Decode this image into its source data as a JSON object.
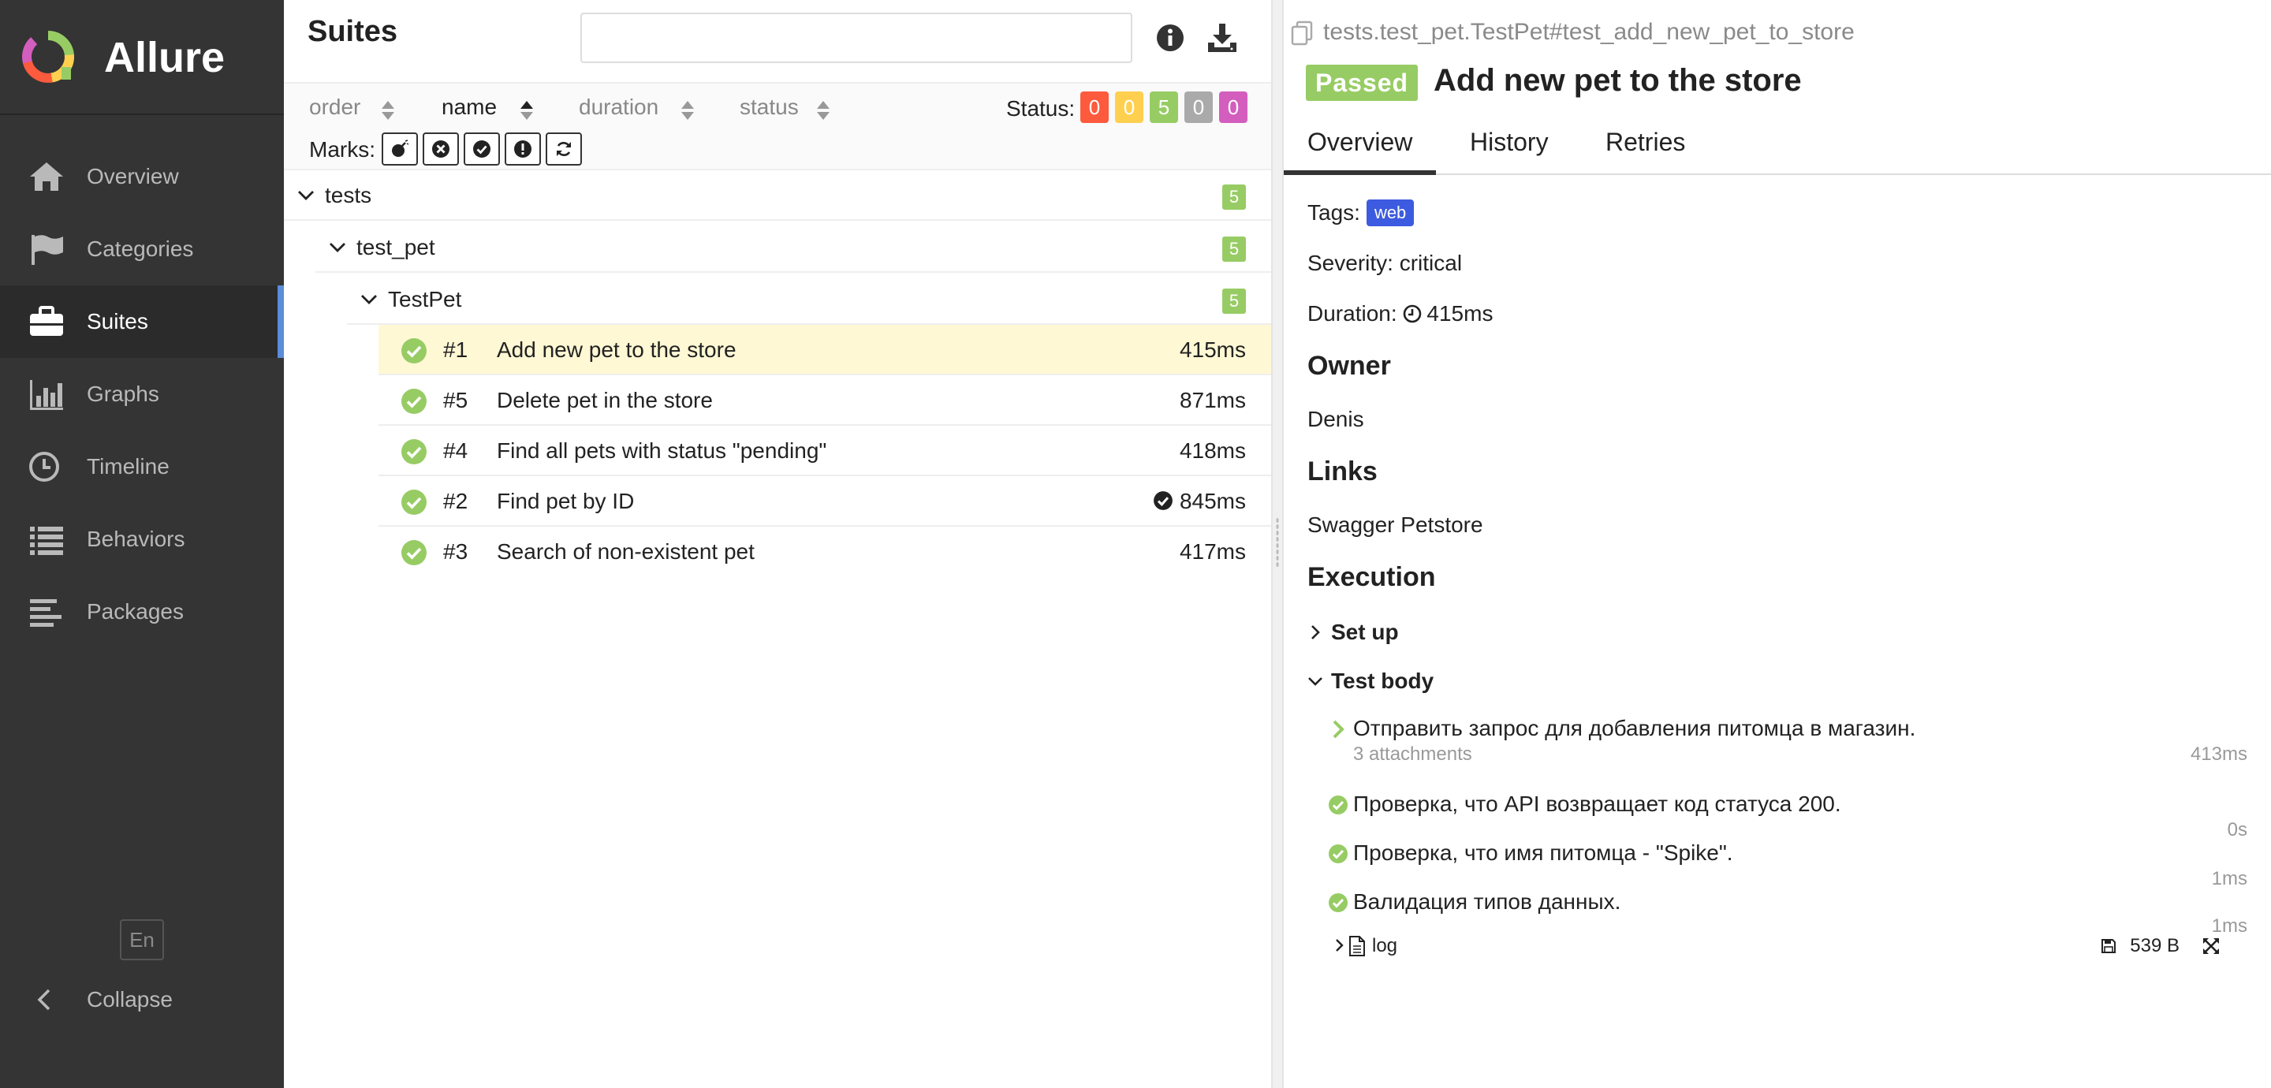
{
  "brand": {
    "name": "Allure"
  },
  "sidebar": {
    "items": [
      {
        "label": "Overview",
        "icon": "home-icon"
      },
      {
        "label": "Categories",
        "icon": "flag-icon"
      },
      {
        "label": "Suites",
        "icon": "briefcase-icon",
        "active": true
      },
      {
        "label": "Graphs",
        "icon": "bar-chart-icon"
      },
      {
        "label": "Timeline",
        "icon": "clock-icon"
      },
      {
        "label": "Behaviors",
        "icon": "list-icon"
      },
      {
        "label": "Packages",
        "icon": "align-left-icon"
      }
    ],
    "language": "En",
    "collapse_label": "Collapse"
  },
  "suites": {
    "title": "Suites",
    "search": {
      "value": "",
      "placeholder": ""
    },
    "sorters": [
      "order",
      "name",
      "duration",
      "status"
    ],
    "active_sorter": "name",
    "status_label": "Status:",
    "status_counts": [
      {
        "value": "0",
        "color": "#fd5a3e"
      },
      {
        "value": "0",
        "color": "#ffd050"
      },
      {
        "value": "5",
        "color": "#97cc64"
      },
      {
        "value": "0",
        "color": "#aaaaaa"
      },
      {
        "value": "0",
        "color": "#d35ebe"
      }
    ],
    "marks_label": "Marks:",
    "marks": [
      "flaky-bomb-icon",
      "new-failed-icon",
      "new-passed-icon",
      "new-broken-icon",
      "retries-icon"
    ],
    "tree": [
      {
        "label": "tests",
        "count": "5"
      },
      {
        "label": "test_pet",
        "count": "5"
      },
      {
        "label": "TestPet",
        "count": "5"
      }
    ],
    "tests": [
      {
        "num": "#1",
        "name": "Add new pet to the store",
        "duration": "415ms",
        "selected": true
      },
      {
        "num": "#5",
        "name": "Delete pet in the store",
        "duration": "871ms"
      },
      {
        "num": "#4",
        "name": "Find all pets with status \"pending\"",
        "duration": "418ms"
      },
      {
        "num": "#2",
        "name": "Find pet by ID",
        "duration": "845ms",
        "flag": "new-passed-icon"
      },
      {
        "num": "#3",
        "name": "Search of non-existent pet",
        "duration": "417ms"
      }
    ]
  },
  "detail": {
    "breadcrumb": "tests.test_pet.TestPet#test_add_new_pet_to_store",
    "status": "Passed",
    "title": "Add new pet to the store",
    "tabs": [
      "Overview",
      "History",
      "Retries"
    ],
    "tags_label": "Tags:",
    "tag": "web",
    "severity": "Severity: critical",
    "duration_label": "Duration:",
    "duration": "415ms",
    "owner_heading": "Owner",
    "owner": "Denis",
    "links_heading": "Links",
    "link": "Swagger Petstore",
    "execution_heading": "Execution",
    "setup_label": "Set up",
    "body_label": "Test body",
    "steps": [
      {
        "text": "Отправить запрос для добавления питомца в магазин.",
        "sub": "3 attachments",
        "duration": "413ms"
      },
      {
        "text": "Проверка, что API возвращает код статуса 200.",
        "duration": "0s"
      },
      {
        "text": "Проверка, что имя питомца - \"Spike\".",
        "duration": "1ms"
      },
      {
        "text": "Валидация типов данных.",
        "duration": "1ms"
      }
    ],
    "attachment": {
      "name": "log",
      "size": "539 B"
    }
  }
}
